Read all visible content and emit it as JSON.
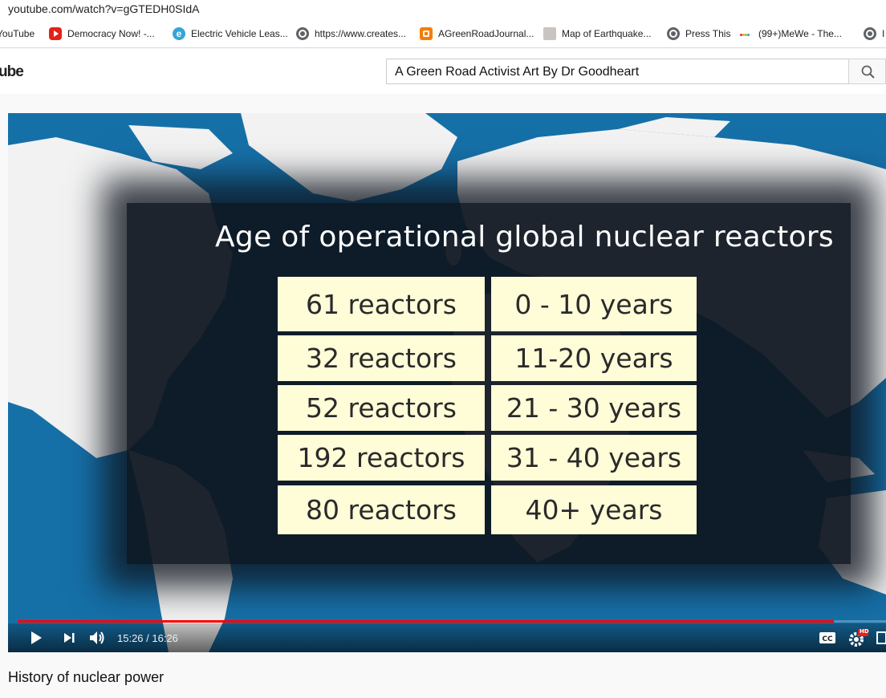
{
  "browser": {
    "url": "youtube.com/watch?v=gGTEDH0SIdA",
    "bookmarks": [
      {
        "label": "YouTube",
        "icon": "youtube-icon"
      },
      {
        "label": "Democracy Now! -...",
        "icon": "youtube-icon"
      },
      {
        "label": "Electric Vehicle Leas...",
        "icon": "e-icon"
      },
      {
        "label": "https://www.creates...",
        "icon": "globe-icon"
      },
      {
        "label": "AGreenRoadJournal...",
        "icon": "blogger-icon"
      },
      {
        "label": "Map of Earthquake...",
        "icon": "map-icon"
      },
      {
        "label": "Press This",
        "icon": "globe-icon"
      },
      {
        "label": "(99+)MeWe - The...",
        "icon": "mewe-icon"
      },
      {
        "label": "I",
        "icon": "globe-icon"
      }
    ]
  },
  "header": {
    "logo": "ube",
    "search_value": "A Green Road Activist Art By Dr Goodheart"
  },
  "slide": {
    "title": "Age of operational global nuclear reactors",
    "rows": [
      {
        "count": "61 reactors",
        "age": "0 - 10 years"
      },
      {
        "count": "32 reactors",
        "age": "11-20 years"
      },
      {
        "count": "52 reactors",
        "age": "21 - 30 years"
      },
      {
        "count": "192 reactors",
        "age": "31 - 40 years"
      },
      {
        "count": "80 reactors",
        "age": "40+ years"
      }
    ]
  },
  "player": {
    "time": "15:26 / 16:26",
    "progress": 0.94,
    "hd_badge": "HD"
  },
  "video_title": "History of nuclear power",
  "colors": {
    "ocean": "#1670a8",
    "land": "#f2f2f2",
    "cell": "#fffcd8",
    "progress": "#ff0000"
  }
}
